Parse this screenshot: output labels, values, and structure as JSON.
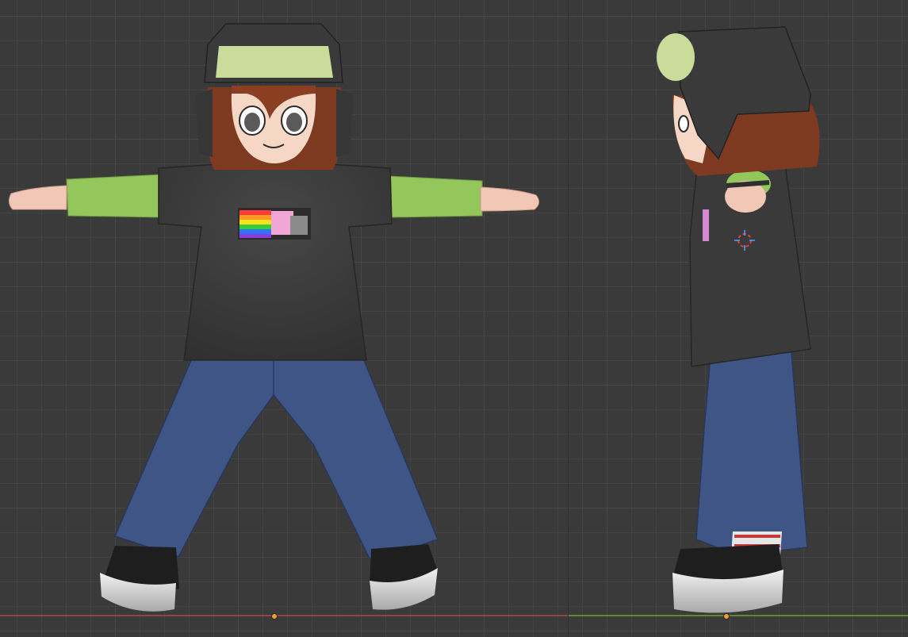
{
  "viewport": {
    "background": "#3a3a3a",
    "grid_color": "#474747",
    "x_axis_color": "#9a3f45",
    "y_axis_color": "#5f8a2c",
    "origin_color": "#f0a030"
  },
  "model": {
    "skin": "#f3c8b6",
    "hair": "#8a3f22",
    "hat_dark": "#3a3a3a",
    "hat_light": "#c9dc9a",
    "sleeve": "#93c75c",
    "shirt": "#3c3c3c",
    "jeans": "#3e5585",
    "shoe": "#1f1f1f",
    "sole": "#d9d9d9"
  },
  "icons": {
    "cursor": "3d-cursor-icon"
  }
}
